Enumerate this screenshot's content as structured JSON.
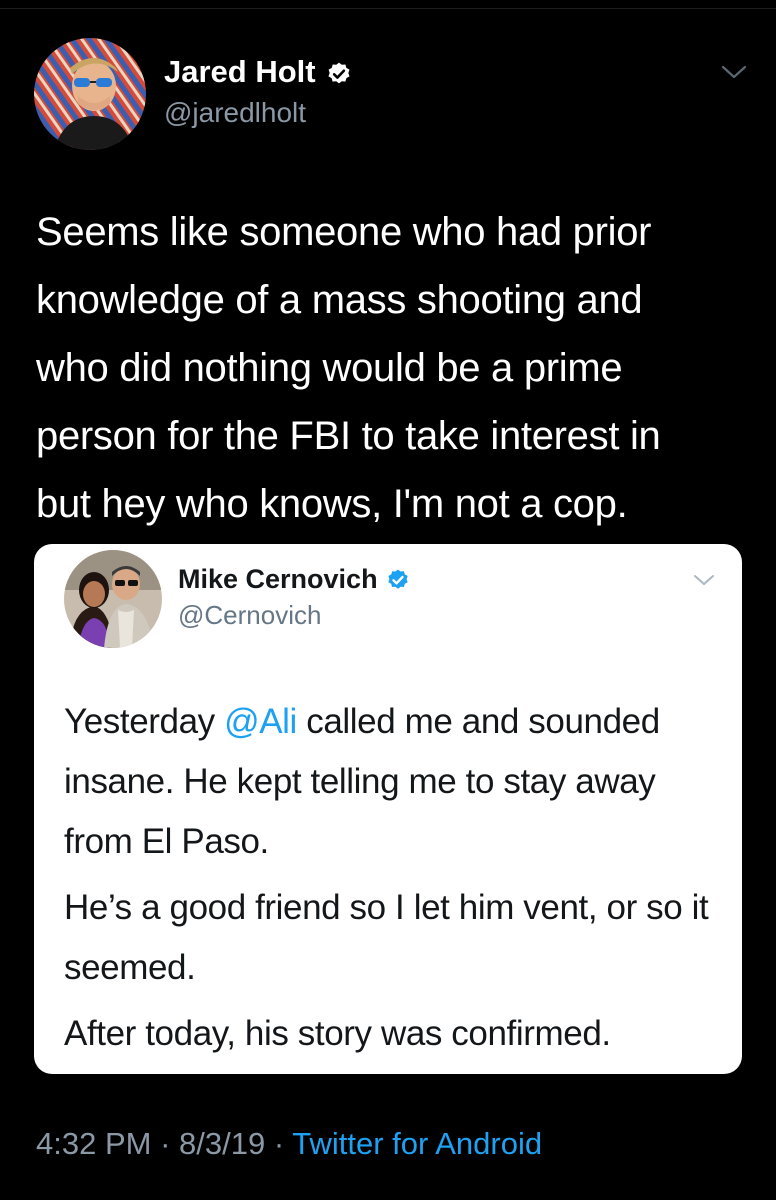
{
  "tweet": {
    "author": {
      "name": "Jared Holt",
      "handle": "@jaredlholt",
      "verified": true,
      "avatar_icon": "profile-photo-icon"
    },
    "text_lines": [
      "Seems like someone who had prior",
      "knowledge of a mass shooting and",
      "who did nothing would be a prime",
      "person for the FBI to take interest in",
      "but hey who knows, I'm not a cop."
    ],
    "time": "4:32 PM",
    "date": "8/3/19",
    "separator": "·",
    "source": "Twitter for Android",
    "menu_icon": "chevron-down-icon"
  },
  "quoted_tweet": {
    "author": {
      "name": "Mike Cernovich",
      "handle": "@Cernovich",
      "verified": true,
      "avatar_icon": "profile-photo-icon"
    },
    "paragraph1": {
      "before": "Yesterday ",
      "mention": "@Ali",
      "after": " called me and sounded insane. He kept telling me to stay away from El Paso."
    },
    "paragraph2": "He’s a good friend so I let him vent, or so it seemed.",
    "paragraph3": "After today, his story was confirmed.",
    "menu_icon": "chevron-down-icon"
  },
  "colors": {
    "background": "#000000",
    "text_primary_dark": "#ffffff",
    "text_secondary_dark": "#8b98a5",
    "card_background": "#ffffff",
    "text_primary_light": "#14171a",
    "text_secondary_light": "#657786",
    "link_blue": "#1da1f2",
    "verified_blue": "#1da1f2"
  }
}
